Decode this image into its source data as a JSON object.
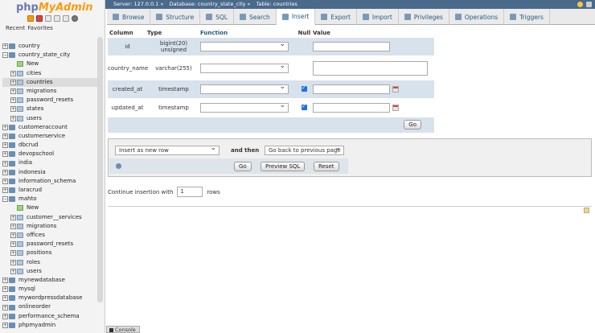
{
  "logo": {
    "php": "php",
    "myadmin": "MyAdmin"
  },
  "nav": {
    "recent": "Recent",
    "favorites": "Favorites"
  },
  "tree": [
    {
      "name": "country",
      "type": "db",
      "sign": "+",
      "level": 0
    },
    {
      "name": "country_state_city",
      "type": "db",
      "sign": "−",
      "level": 0
    },
    {
      "name": "New",
      "type": "new",
      "sign": "",
      "level": 1
    },
    {
      "name": "cities",
      "type": "tbl",
      "sign": "+",
      "level": 1
    },
    {
      "name": "countries",
      "type": "tbl",
      "sign": "+",
      "level": 1,
      "selected": true
    },
    {
      "name": "migrations",
      "type": "tbl",
      "sign": "+",
      "level": 1
    },
    {
      "name": "password_resets",
      "type": "tbl",
      "sign": "+",
      "level": 1
    },
    {
      "name": "states",
      "type": "tbl",
      "sign": "+",
      "level": 1
    },
    {
      "name": "users",
      "type": "tbl",
      "sign": "+",
      "level": 1
    },
    {
      "name": "customeraccount",
      "type": "db",
      "sign": "+",
      "level": 0
    },
    {
      "name": "customerservice",
      "type": "db",
      "sign": "+",
      "level": 0
    },
    {
      "name": "dbcrud",
      "type": "db",
      "sign": "+",
      "level": 0
    },
    {
      "name": "devopschool",
      "type": "db",
      "sign": "+",
      "level": 0
    },
    {
      "name": "india",
      "type": "db",
      "sign": "+",
      "level": 0
    },
    {
      "name": "indonesia",
      "type": "db",
      "sign": "+",
      "level": 0
    },
    {
      "name": "information_schema",
      "type": "db",
      "sign": "+",
      "level": 0
    },
    {
      "name": "laracrud",
      "type": "db",
      "sign": "+",
      "level": 0
    },
    {
      "name": "mahto",
      "type": "db",
      "sign": "−",
      "level": 0
    },
    {
      "name": "New",
      "type": "new",
      "sign": "",
      "level": 1
    },
    {
      "name": "customer__services",
      "type": "tbl",
      "sign": "+",
      "level": 1
    },
    {
      "name": "migrations",
      "type": "tbl",
      "sign": "+",
      "level": 1
    },
    {
      "name": "offices",
      "type": "tbl",
      "sign": "+",
      "level": 1
    },
    {
      "name": "password_resets",
      "type": "tbl",
      "sign": "+",
      "level": 1
    },
    {
      "name": "positions",
      "type": "tbl",
      "sign": "+",
      "level": 1
    },
    {
      "name": "roles",
      "type": "tbl",
      "sign": "+",
      "level": 1
    },
    {
      "name": "users",
      "type": "tbl",
      "sign": "+",
      "level": 1
    },
    {
      "name": "mynewdatabase",
      "type": "db",
      "sign": "+",
      "level": 0
    },
    {
      "name": "mysql",
      "type": "db",
      "sign": "+",
      "level": 0
    },
    {
      "name": "mywordpressdatabase",
      "type": "db",
      "sign": "+",
      "level": 0
    },
    {
      "name": "onlineorder",
      "type": "db",
      "sign": "+",
      "level": 0
    },
    {
      "name": "performance_schema",
      "type": "db",
      "sign": "+",
      "level": 0
    },
    {
      "name": "phpmyadmin",
      "type": "db",
      "sign": "+",
      "level": 0
    }
  ],
  "breadcrumb": {
    "server": "Server: 127.0.0.1 »",
    "database": "Database: country_state_city »",
    "table": "Table: countries"
  },
  "tabs": [
    {
      "label": "Browse",
      "active": false
    },
    {
      "label": "Structure",
      "active": false
    },
    {
      "label": "SQL",
      "active": false
    },
    {
      "label": "Search",
      "active": false
    },
    {
      "label": "Insert",
      "active": true
    },
    {
      "label": "Export",
      "active": false
    },
    {
      "label": "Import",
      "active": false
    },
    {
      "label": "Privileges",
      "active": false
    },
    {
      "label": "Operations",
      "active": false
    },
    {
      "label": "Triggers",
      "active": false
    }
  ],
  "insert": {
    "headers": {
      "column": "Column",
      "type": "Type",
      "function": "Function",
      "null": "Null",
      "value": "Value"
    },
    "rows": [
      {
        "column": "id",
        "type": "bigint(20) unsigned",
        "null_checked": false,
        "value_kind": "text",
        "calendar": false
      },
      {
        "column": "country_name",
        "type": "varchar(255)",
        "null_checked": false,
        "value_kind": "textarea",
        "calendar": false
      },
      {
        "column": "created_at",
        "type": "timestamp",
        "null_checked": true,
        "value_kind": "text",
        "calendar": true
      },
      {
        "column": "updated_at",
        "type": "timestamp",
        "null_checked": true,
        "value_kind": "text",
        "calendar": true
      }
    ],
    "go_label": "Go"
  },
  "action": {
    "insert_mode": "Insert as new row",
    "and_then": "and then",
    "after_insert": "Go back to previous page",
    "go_label": "Go",
    "preview_label": "Preview SQL",
    "reset_label": "Reset"
  },
  "continue": {
    "prefix": "Continue insertion with",
    "count": "1",
    "suffix": "rows"
  },
  "console": {
    "label": "Console"
  }
}
